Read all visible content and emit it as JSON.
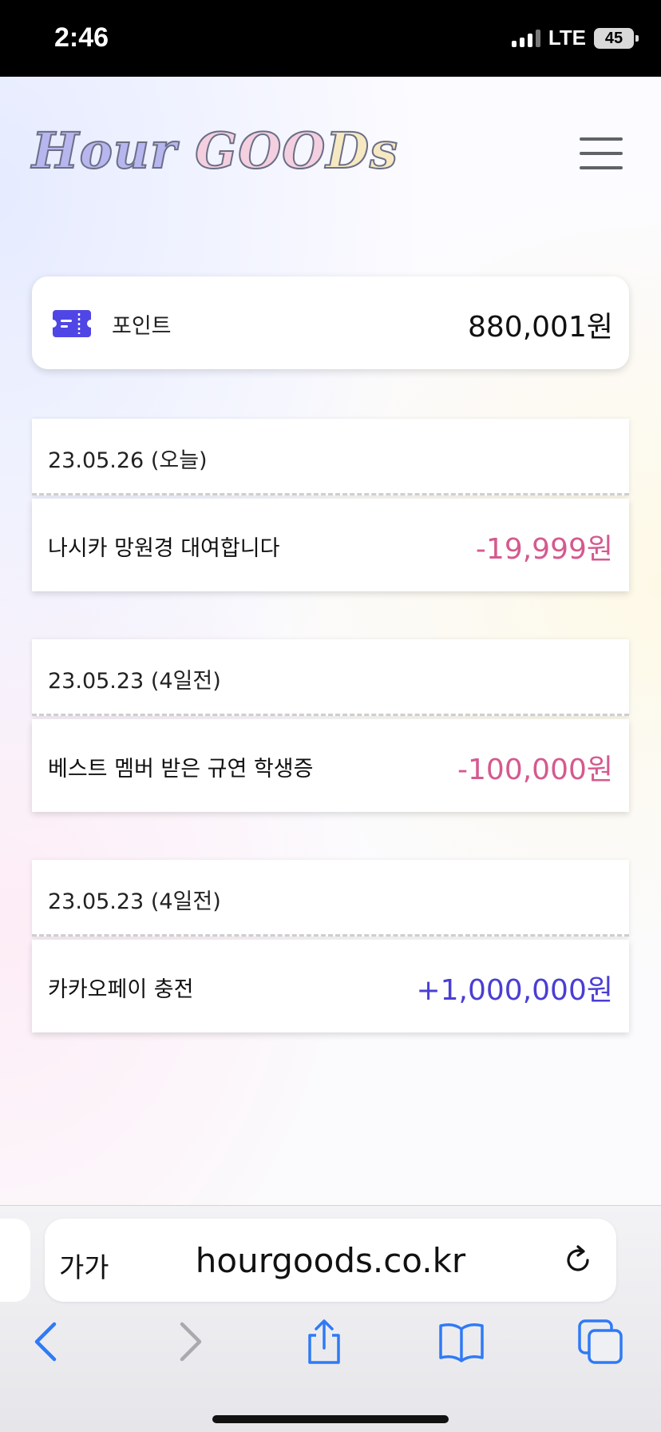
{
  "status_bar": {
    "time": "2:46",
    "network": "LTE",
    "battery": "45"
  },
  "header": {
    "logo_word1": "Hour",
    "logo_word2": "GOO",
    "logo_word3": "Ds"
  },
  "points": {
    "label": "포인트",
    "value": "880,001원"
  },
  "transactions": [
    {
      "date": "23.05.26 (오늘)",
      "title": "나시카 망원경 대여합니다",
      "amount": "-19,999원"
    },
    {
      "date": "23.05.23 (4일전)",
      "title": "베스트 멤버 받은 규연 학생증",
      "amount": "-100,000원"
    },
    {
      "date": "23.05.23 (4일전)",
      "title": "카카오페이 충전",
      "amount": "+1,000,000원"
    }
  ],
  "browser": {
    "text_size_label": "가가",
    "url": "hourgoods.co.kr"
  },
  "colors": {
    "negative": "#d45a8f",
    "positive": "#4a3ed4",
    "accent": "#4f46e5",
    "ios_blue": "#2f7af5"
  },
  "icons": [
    "ticket-icon",
    "menu-icon",
    "reload-icon",
    "back-icon",
    "forward-icon",
    "share-icon",
    "bookmarks-icon",
    "tabs-icon"
  ]
}
